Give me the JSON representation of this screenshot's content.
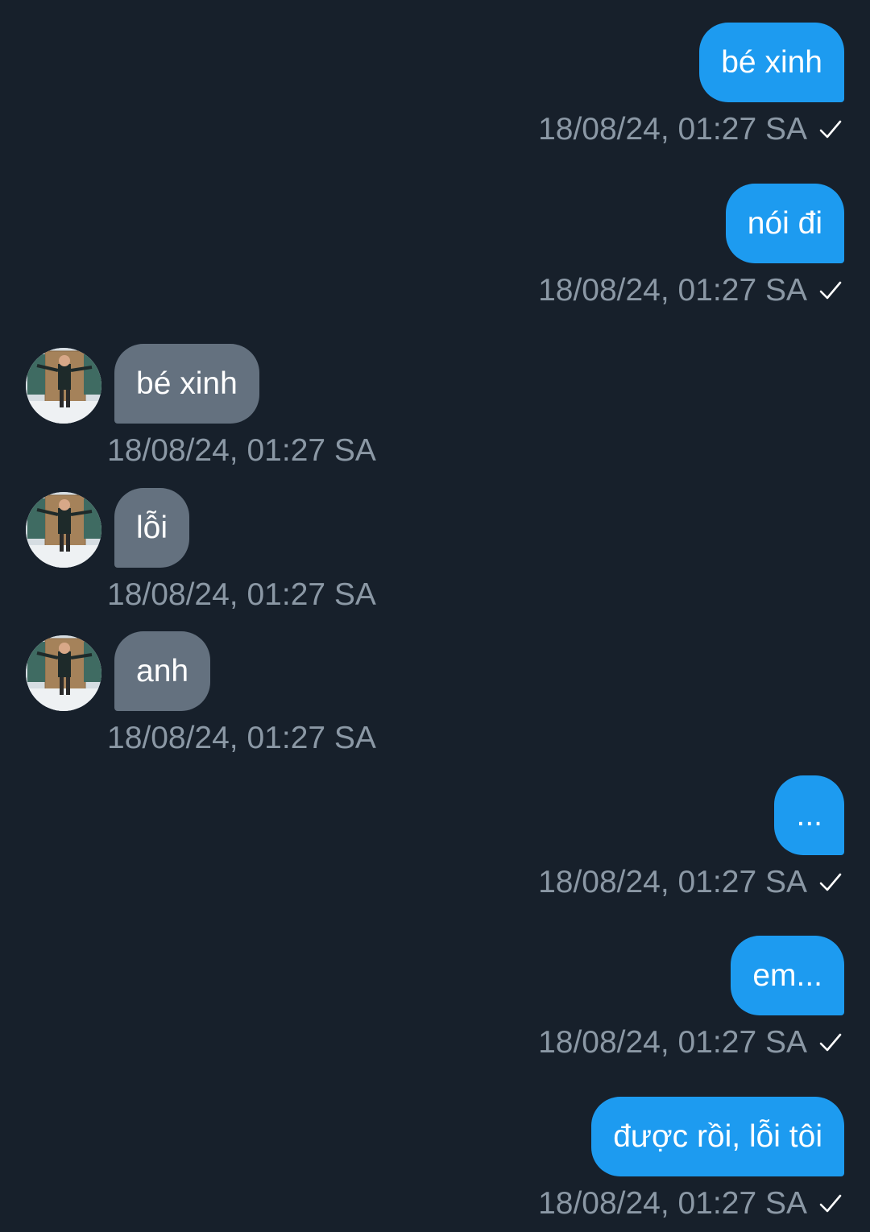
{
  "conversation": {
    "messages": [
      {
        "direction": "outgoing",
        "text": "bé xinh",
        "timestamp": "18/08/24, 01:27 SA",
        "status_icon": "checkmark-icon"
      },
      {
        "direction": "outgoing",
        "text": "nói đi",
        "timestamp": "18/08/24, 01:27 SA",
        "status_icon": "checkmark-icon"
      },
      {
        "direction": "incoming",
        "text": "bé xinh",
        "timestamp": "18/08/24, 01:27 SA",
        "avatar_icon": "contact-avatar"
      },
      {
        "direction": "incoming",
        "text": "lỗi",
        "timestamp": "18/08/24, 01:27 SA",
        "avatar_icon": "contact-avatar"
      },
      {
        "direction": "incoming",
        "text": "anh",
        "timestamp": "18/08/24, 01:27 SA",
        "avatar_icon": "contact-avatar"
      },
      {
        "direction": "outgoing",
        "text": "...",
        "timestamp": "18/08/24, 01:27 SA",
        "status_icon": "checkmark-icon"
      },
      {
        "direction": "outgoing",
        "text": "em...",
        "timestamp": "18/08/24, 01:27 SA",
        "status_icon": "checkmark-icon"
      },
      {
        "direction": "outgoing",
        "text": "được rồi, lỗi tôi",
        "timestamp": "18/08/24, 01:27 SA",
        "status_icon": "checkmark-icon"
      }
    ]
  },
  "colors": {
    "background": "#17202b",
    "outgoing_bubble": "#1d9bf0",
    "incoming_bubble": "#64717f",
    "timestamp_text": "#8b98a5",
    "message_text": "#ffffff"
  }
}
